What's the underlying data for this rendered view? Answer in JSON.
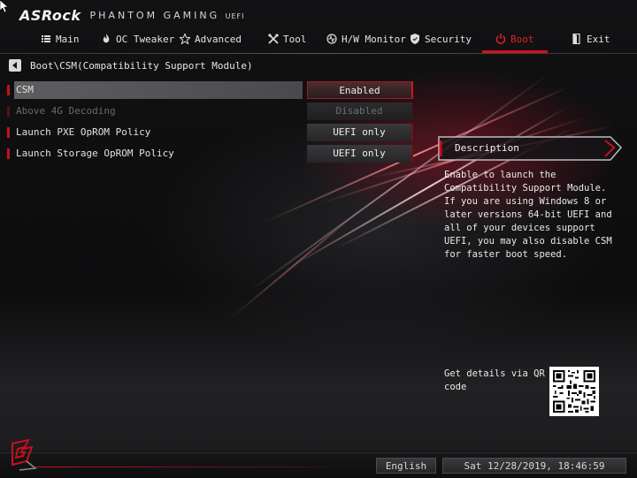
{
  "logo": {
    "brand": "ASRock",
    "product": "PHANTOM GAMING",
    "suffix": "UEFI"
  },
  "nav": [
    {
      "label": "Main",
      "icon": "list-icon"
    },
    {
      "label": "OC Tweaker",
      "icon": "flame-icon"
    },
    {
      "label": "Advanced",
      "icon": "star-icon"
    },
    {
      "label": "Tool",
      "icon": "wrench-icon"
    },
    {
      "label": "H/W Monitor",
      "icon": "monitor-icon"
    },
    {
      "label": "Security",
      "icon": "shield-icon"
    },
    {
      "label": "Boot",
      "icon": "power-icon",
      "active": true
    },
    {
      "label": "Exit",
      "icon": "exit-icon"
    }
  ],
  "breadcrumb": "Boot\\CSM(Compatibility Support Module)",
  "settings": [
    {
      "label": "CSM",
      "value": "Enabled",
      "state": "selected"
    },
    {
      "label": "Above 4G Decoding",
      "value": "Disabled",
      "state": "disabled"
    },
    {
      "label": "Launch PXE OpROM Policy",
      "value": "UEFI only",
      "state": "normal"
    },
    {
      "label": "Launch Storage OpROM Policy",
      "value": "UEFI only",
      "state": "normal"
    }
  ],
  "description": {
    "title": "Description",
    "text": "Enable to launch the Compatibility Support Module. If you are using Windows 8 or later versions 64-bit UEFI and all of your devices support UEFI, you may also disable CSM for faster boot speed."
  },
  "qr": {
    "text": "Get details via QR code"
  },
  "footer": {
    "language": "English",
    "datetime": "Sat 12/28/2019, 18:46:59"
  },
  "colors": {
    "accent": "#d4111b",
    "selected_row": "#5e5e60",
    "background": "#0b0b0c"
  }
}
